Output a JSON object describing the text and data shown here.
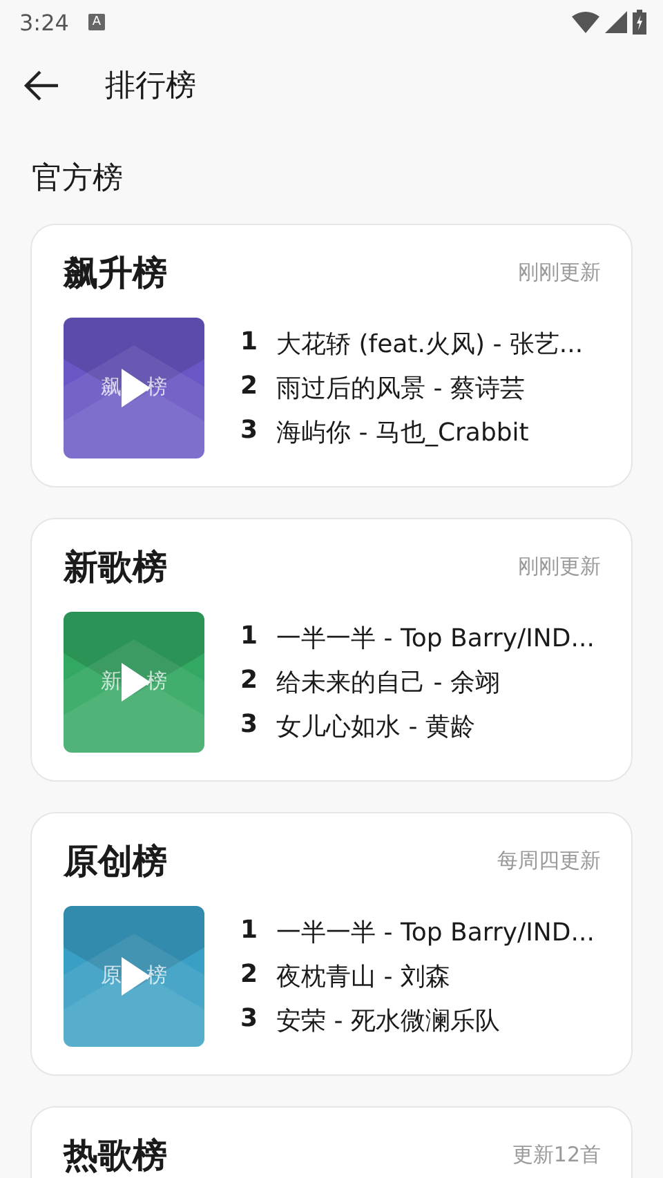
{
  "status_bar": {
    "time": "3:24",
    "badge": "A"
  },
  "app_bar": {
    "title": "排行榜"
  },
  "section": {
    "title": "官方榜"
  },
  "charts": [
    {
      "title": "飙升榜",
      "update": "刚刚更新",
      "color": "#6a56c4",
      "cover_label": [
        "飙",
        "榜"
      ],
      "songs": [
        {
          "rank": "1",
          "text": "大花轿 (feat.火风) - 张艺..."
        },
        {
          "rank": "2",
          "text": "雨过后的风景 - 蔡诗芸"
        },
        {
          "rank": "3",
          "text": "海屿你 - 马也_Crabbit"
        }
      ]
    },
    {
      "title": "新歌榜",
      "update": "刚刚更新",
      "color": "#32a862",
      "cover_label": [
        "新",
        "榜"
      ],
      "songs": [
        {
          "rank": "1",
          "text": "一半一半 - Top Barry/IND..."
        },
        {
          "rank": "2",
          "text": "给未来的自己 - 余翊"
        },
        {
          "rank": "3",
          "text": "女儿心如水 - 黄龄"
        }
      ]
    },
    {
      "title": "原创榜",
      "update": "每周四更新",
      "color": "#3a9fc4",
      "cover_label": [
        "原",
        "榜"
      ],
      "songs": [
        {
          "rank": "1",
          "text": "一半一半 - Top Barry/IND..."
        },
        {
          "rank": "2",
          "text": "夜枕青山 - 刘森"
        },
        {
          "rank": "3",
          "text": "安荣 - 死水微澜乐队"
        }
      ]
    },
    {
      "title": "热歌榜",
      "update": "更新12首"
    }
  ]
}
